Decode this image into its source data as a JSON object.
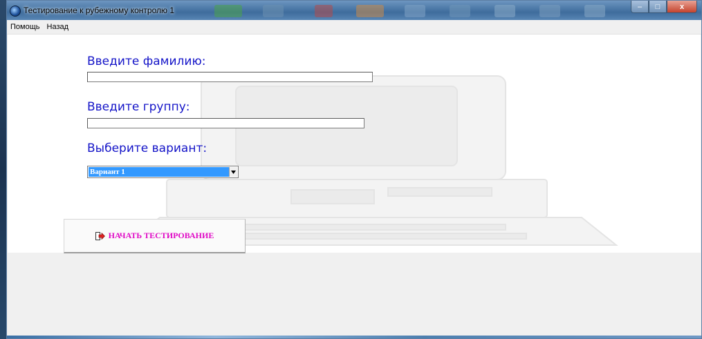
{
  "window": {
    "title": "Тестирование к рубежному контролю 1",
    "controls": {
      "minimize": "–",
      "maximize": "□",
      "close": "x"
    }
  },
  "menu": {
    "items": [
      {
        "label": "Помощь"
      },
      {
        "label": "Назад"
      }
    ]
  },
  "form": {
    "surname_label": "Введите фамилию:",
    "surname_value": "",
    "group_label": "Введите группу:",
    "group_value": "",
    "variant_label": "Выберите вариант:",
    "variant_selected": "Вариант 1"
  },
  "actions": {
    "start_label": "НАЧАТЬ ТЕСТИРОВАНИЕ",
    "start_icon": "door-exit-arrow-icon"
  },
  "colors": {
    "label_blue": "#1414c8",
    "button_text_magenta": "#e00ac6",
    "selection_blue": "#3399ff"
  }
}
